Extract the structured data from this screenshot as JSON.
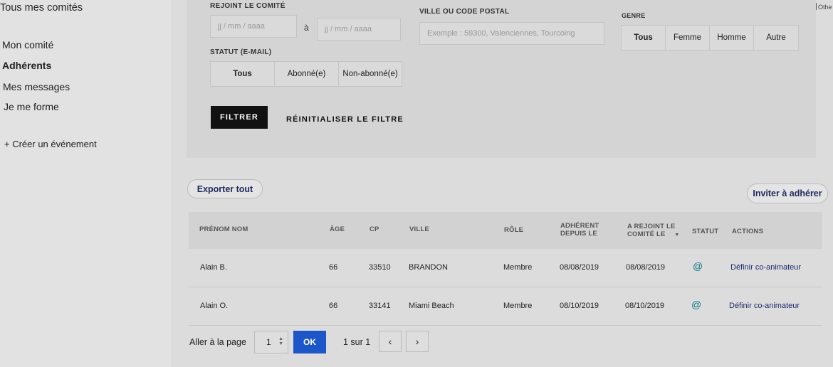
{
  "sidebar": {
    "title": "Tous mes comités",
    "items": [
      "Mon comité",
      "Adhérents",
      "Mes messages",
      "Je me forme"
    ],
    "create_event": "+ Créer un événement"
  },
  "bookmarks": {
    "other": "Othe"
  },
  "filters": {
    "joined_label": "REJOINT LE COMITÉ",
    "date_from_placeholder": "jj / mm / aaaa",
    "date_sep": "à",
    "date_to_placeholder": "jj / mm / aaaa",
    "city_label": "VILLE OU CODE POSTAL",
    "city_placeholder": "Exemple : 59300, Valenciennes, Tourcoing",
    "gender_label": "GENRE",
    "gender_options": [
      "Tous",
      "Femme",
      "Homme",
      "Autre"
    ],
    "status_label": "STATUT (E-MAIL)",
    "status_options": [
      "Tous",
      "Abonné(e)",
      "Non-abonné(e)"
    ],
    "filter_button": "FILTRER",
    "reset_button": "RÉINITIALISER LE FILTRE"
  },
  "actions": {
    "export_all": "Exporter tout",
    "invite": "Inviter à adhérer"
  },
  "table": {
    "headers": {
      "name": "PRÉNOM NOM",
      "age": "ÂGE",
      "cp": "CP",
      "city": "VILLE",
      "role": "RÔLE",
      "member_since_1": "ADHÉRENT",
      "member_since_2": "DEPUIS LE",
      "joined_1": "A REJOINT LE",
      "joined_2": "COMITÉ LE",
      "status": "STATUT",
      "actions": "ACTIONS"
    },
    "rows": [
      {
        "name": "Alain B.",
        "age": "66",
        "cp": "33510",
        "city": "BRANDON",
        "role": "Membre",
        "member_since": "08/08/2019",
        "joined": "08/08/2019",
        "status": "@",
        "action": "Définir co-animateur"
      },
      {
        "name": "Alain O.",
        "age": "66",
        "cp": "33141",
        "city": "Miami Beach",
        "role": "Membre",
        "member_since": "08/10/2019",
        "joined": "08/10/2019",
        "status": "@",
        "action": "Définir co-animateur"
      }
    ]
  },
  "pagination": {
    "goto_label": "Aller à la page",
    "page_value": "1",
    "ok": "OK",
    "page_info": "1 sur 1",
    "prev_icon": "chevron-left-icon",
    "next_icon": "chevron-right-icon"
  }
}
